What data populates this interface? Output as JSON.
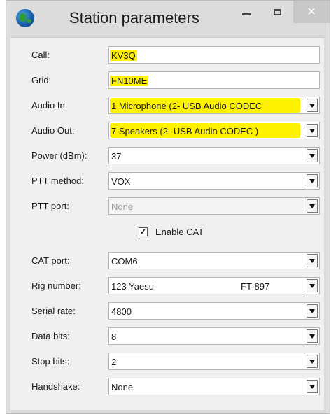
{
  "window": {
    "title": "Station parameters",
    "minimize_icon": "minimize-icon",
    "maximize_icon": "maximize-icon",
    "close_icon": "close-icon"
  },
  "fields": {
    "call": {
      "label": "Call:",
      "value": "KV3Q"
    },
    "grid": {
      "label": "Grid:",
      "value": "FN10ME"
    },
    "audio_in": {
      "label": "Audio In:",
      "value": "1 Microphone (2- USB Audio CODEC"
    },
    "audio_out": {
      "label": "Audio Out:",
      "value": "7 Speakers (2- USB Audio CODEC )"
    },
    "power": {
      "label": "Power (dBm):",
      "value": "37"
    },
    "ptt_method": {
      "label": "PTT method:",
      "value": "VOX"
    },
    "ptt_port": {
      "label": "PTT port:",
      "value": "None"
    },
    "enable_cat": {
      "label": "Enable CAT",
      "checked": true,
      "check_mark": "✓"
    },
    "cat_port": {
      "label": "CAT port:",
      "value": "COM6"
    },
    "rig_number": {
      "label": "Rig number:",
      "value": "123 Yaesu",
      "model": "FT-897"
    },
    "serial_rate": {
      "label": "Serial rate:",
      "value": "4800"
    },
    "data_bits": {
      "label": "Data bits:",
      "value": "8"
    },
    "stop_bits": {
      "label": "Stop bits:",
      "value": "2"
    },
    "handshake": {
      "label": "Handshake:",
      "value": "None"
    }
  },
  "colors": {
    "highlight": "#fff200",
    "window_bg": "#dcdcdc",
    "client_bg": "#f0f0f0"
  }
}
